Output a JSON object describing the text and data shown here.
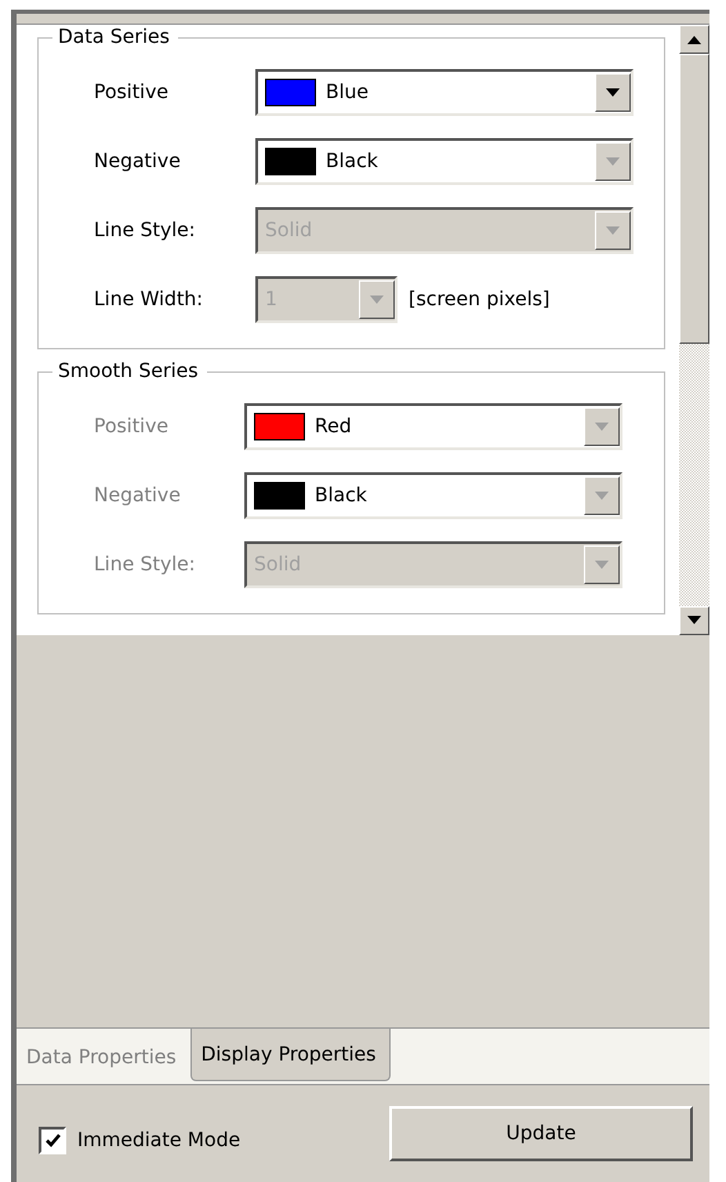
{
  "groups": [
    {
      "title": "Data Series",
      "disabled": false,
      "rows": [
        {
          "label": "Positive",
          "kind": "color",
          "value": "Blue",
          "color": "#0000ff",
          "disabled": false,
          "arrow_enabled": true
        },
        {
          "label": "Negative",
          "kind": "color",
          "value": "Black",
          "color": "#000000",
          "disabled": false,
          "arrow_enabled": false
        },
        {
          "label": "Line Style:",
          "kind": "select",
          "value": "Solid",
          "disabled": true,
          "arrow_enabled": false
        },
        {
          "label": "Line Width:",
          "kind": "width",
          "value": "1",
          "suffix": "[screen pixels]",
          "disabled": true,
          "arrow_enabled": false
        }
      ]
    },
    {
      "title": "Smooth Series",
      "disabled": true,
      "rows": [
        {
          "label": "Positive",
          "kind": "color",
          "value": "Red",
          "color": "#ff0000",
          "disabled": false,
          "arrow_enabled": false
        },
        {
          "label": "Negative",
          "kind": "color",
          "value": "Black",
          "color": "#000000",
          "disabled": false,
          "arrow_enabled": false
        },
        {
          "label": "Line Style:",
          "kind": "select",
          "value": "Solid",
          "disabled": true,
          "arrow_enabled": false
        }
      ]
    }
  ],
  "tabs": [
    {
      "label": "Data Properties",
      "selected": false
    },
    {
      "label": "Display Properties",
      "selected": true
    }
  ],
  "immediate_mode": {
    "label": "Immediate Mode",
    "checked": true
  },
  "update_button": "Update"
}
